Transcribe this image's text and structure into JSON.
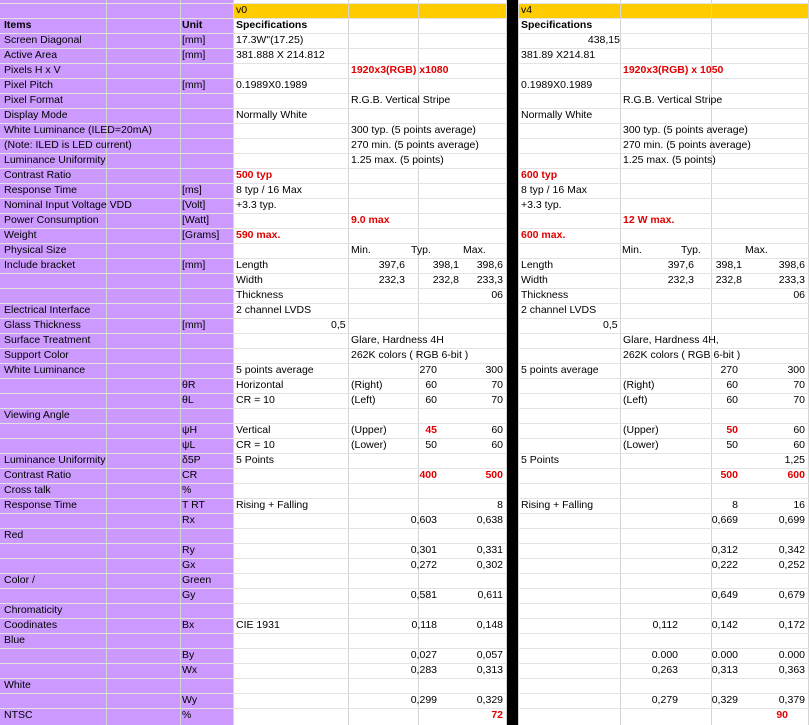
{
  "colors": {
    "items_bg": "#cc99ff",
    "version_header_bg": "#ffcc00",
    "separator": "#000000",
    "red_text": "#e00000"
  },
  "header": {
    "items": "Items",
    "unit": "Unit",
    "v0": "v0",
    "v4": "v4",
    "v0_spec": "Specifications",
    "v4_spec": "Specifications"
  },
  "items": [
    "Screen Diagonal",
    "Active Area",
    "Pixels H x V",
    "Pixel Pitch",
    "Pixel Format",
    "Display Mode",
    "White Luminance (ILED=20mA)",
    "(Note: ILED is LED current)",
    "Luminance Uniformity",
    "Contrast Ratio",
    "Response Time",
    "Nominal Input Voltage VDD",
    "Power Consumption",
    "Weight",
    "Physical Size",
    "Include bracket",
    "",
    "",
    "Electrical Interface",
    "Glass Thickness",
    "Surface Treatment",
    "Support Color",
    "White Luminance",
    "",
    "",
    "Viewing Angle",
    "",
    "",
    "Luminance Uniformity",
    "Contrast Ratio",
    "Cross talk",
    "Response Time",
    "",
    "Red",
    "",
    "",
    "Color /",
    "",
    "Chromaticity",
    "Coodinates",
    "Blue",
    "",
    "",
    "White",
    "",
    "NTSC"
  ],
  "units": [
    "[mm]",
    "[mm]",
    "",
    "[mm]",
    "",
    "",
    "",
    "",
    "",
    "",
    "[ms]",
    "[Volt]",
    "[Watt]",
    "[Grams]",
    "",
    "[mm]",
    "",
    "",
    "",
    "[mm]",
    "",
    "",
    "",
    "θR",
    "θL",
    "",
    "ψH",
    "ψL",
    "δ5P",
    "CR",
    "%",
    "T RT",
    "Rx",
    "",
    "Ry",
    "Gx",
    "Green",
    "Gy",
    "",
    "Bx",
    "",
    "By",
    "Wx",
    "",
    "Wy",
    "%"
  ],
  "v0": {
    "diag": "17.3W\"(17.25)",
    "area": "381.888 X 214.812",
    "pixels": "1920x3(RGB) x1080",
    "pitch": "0.1989X0.1989",
    "format": "R.G.B. Vertical Stripe",
    "mode": "Normally White",
    "lum1": "300 typ. (5 points average)",
    "lum2": "270 min. (5 points average)",
    "uni": "1.25 max. (5 points)",
    "contrast": "500 typ",
    "resp": "8 typ / 16 Max",
    "volt": "+3.3 typ.",
    "power": "9.0 max",
    "weight": "590 max.",
    "min": "Min.",
    "typ": "Typ.",
    "max": "Max.",
    "len_l": "Length",
    "len_min": "397,6",
    "len_typ": "398,1",
    "len_max": "398,6",
    "wid_l": "Width",
    "wid_min": "232,3",
    "wid_typ": "232,8",
    "wid_max": "233,3",
    "thk_l": "Thickness",
    "thk_max": "06",
    "elec": "2 channel LVDS",
    "glass": "0,5",
    "surface": "Glare, Hardness 4H",
    "color": "262K colors ( RGB 6-bit )",
    "wl_l": "5 points average",
    "wl_typ": "270",
    "wl_max": "300",
    "hor": "Horizontal",
    "right": "(Right)",
    "r_typ": "60",
    "r_max": "70",
    "cr10a": "CR = 10",
    "left": "(Left)",
    "l_typ": "60",
    "l_max": "70",
    "vert": "Vertical",
    "upper": "(Upper)",
    "u_typ": "45",
    "u_max": "60",
    "cr10b": "CR = 10",
    "lower": "(Lower)",
    "lo_typ": "50",
    "lo_max": "60",
    "five": "5 Points",
    "cr_typ": "400",
    "cr_max": "500",
    "rise": "Rising + Falling",
    "rise_max": "8",
    "rx_typ": "0,603",
    "rx_max": "0,638",
    "ry_typ": "0,301",
    "ry_max": "0,331",
    "gx_typ": "0,272",
    "gx_max": "0,302",
    "gy_typ": "0,581",
    "gy_max": "0,611",
    "cie": "CIE 1931",
    "bx_typ": "0,118",
    "bx_max": "0,148",
    "by_typ": "0,027",
    "by_max": "0,057",
    "wx_typ": "0,283",
    "wx_max": "0,313",
    "wy_typ": "0,299",
    "wy_max": "0,329",
    "ntsc": "72"
  },
  "v4": {
    "diag": "438,15",
    "area": "381.89 X214.81",
    "pixels": "1920x3(RGB) x 1050",
    "pitch": "0.1989X0.1989",
    "format": "R.G.B. Vertical Stripe",
    "mode": "Normally White",
    "lum1": "300 typ. (5 points average)",
    "lum2": "270 min. (5 points average)",
    "uni": "1.25 max. (5 points)",
    "contrast": "600 typ",
    "resp": "8 typ / 16 Max",
    "volt": "+3.3 typ.",
    "power": "12 W max.",
    "weight": "600 max.",
    "min": "Min.",
    "typ": "Typ.",
    "max": "Max.",
    "len_l": "Length",
    "len_min": "397,6",
    "len_typ": "398,1",
    "len_max": "398,6",
    "wid_l": "Width",
    "wid_min": "232,3",
    "wid_typ": "232,8",
    "wid_max": "233,3",
    "thk_l": "Thickness",
    "thk_max": "06",
    "elec": "2 channel LVDS",
    "glass": "0,5",
    "surface": "Glare, Hardness 4H,",
    "color": "262K colors ( RGB 6-bit )",
    "wl_l": "5 points average",
    "wl_typ": "270",
    "wl_max": "300",
    "right": "(Right)",
    "r_typ": "60",
    "r_max": "70",
    "left": "(Left)",
    "l_typ": "60",
    "l_max": "70",
    "upper": "(Upper)",
    "u_typ": "50",
    "u_max": "60",
    "lower": "(Lower)",
    "lo_typ": "50",
    "lo_max": "60",
    "five": "5 Points",
    "five_max": "1,25",
    "cr_typ": "500",
    "cr_max": "600",
    "rise": "Rising + Falling",
    "rise_typ": "8",
    "rise_max": "16",
    "rx_typ": "0,669",
    "rx_max": "0,699",
    "ry_typ": "0,312",
    "ry_max": "0,342",
    "gx_typ": "0,222",
    "gx_max": "0,252",
    "gy_typ": "0,649",
    "gy_max": "0,679",
    "bx_min": "0,112",
    "bx_typ": "0,142",
    "bx_max": "0,172",
    "by_min": "0.000",
    "by_typ": "0.000",
    "by_max": "0.000",
    "wx_min": "0,263",
    "wx_typ": "0,313",
    "wx_max": "0,363",
    "wy_min": "0,279",
    "wy_typ": "0,329",
    "wy_max": "0,379",
    "ntsc": "90"
  }
}
